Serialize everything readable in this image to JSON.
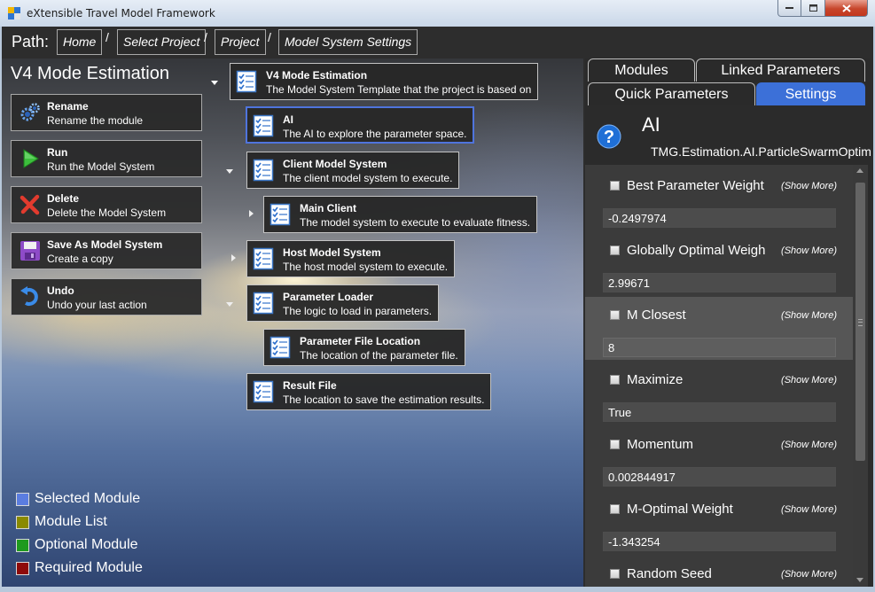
{
  "window": {
    "title": "eXtensible Travel Model Framework"
  },
  "path": {
    "label": "Path:",
    "separator": "/",
    "crumbs": [
      "Home",
      "Select Project",
      "Project",
      "Model System Settings"
    ]
  },
  "left": {
    "title": "V4 Mode Estimation",
    "actions": [
      {
        "icon": "gears-icon",
        "title": "Rename",
        "subtitle": "Rename the module"
      },
      {
        "icon": "play-icon",
        "title": "Run",
        "subtitle": "Run the Model System"
      },
      {
        "icon": "delete-x-icon",
        "title": "Delete",
        "subtitle": "Delete the Model System"
      },
      {
        "icon": "floppy-disk-icon",
        "title": "Save As Model System",
        "subtitle": "Create a copy"
      },
      {
        "icon": "undo-icon",
        "title": "Undo",
        "subtitle": "Undo your last action"
      }
    ],
    "tree": [
      {
        "title": "V4 Mode Estimation",
        "description": "The Model System Template that the project is based on",
        "selected": false
      },
      {
        "title": "AI",
        "description": "The AI to explore the parameter space.",
        "selected": true
      },
      {
        "title": "Client Model System",
        "description": "The client model system to execute.",
        "selected": false
      },
      {
        "title": "Main Client",
        "description": "The model system to execute to evaluate fitness.",
        "selected": false
      },
      {
        "title": "Host Model System",
        "description": "The host model system to execute.",
        "selected": false
      },
      {
        "title": "Parameter Loader",
        "description": "The logic to load in parameters.",
        "selected": false
      },
      {
        "title": "Parameter File Location",
        "description": "The location of the parameter file.",
        "selected": false
      },
      {
        "title": "Result File",
        "description": "The location to save the estimation results.",
        "selected": false
      }
    ],
    "legend": [
      {
        "label": "Selected Module",
        "color": "#5b7de0"
      },
      {
        "label": "Module List",
        "color": "#8a8a00"
      },
      {
        "label": "Optional Module",
        "color": "#1e9a1e"
      },
      {
        "label": "Required Module",
        "color": "#8e0a0a"
      }
    ]
  },
  "right": {
    "tabs": [
      {
        "label": "Modules",
        "active": false
      },
      {
        "label": "Linked Parameters",
        "active": false
      },
      {
        "label": "Quick Parameters",
        "active": false
      },
      {
        "label": "Settings",
        "active": true
      }
    ],
    "header": {
      "icon": "help-icon",
      "name": "AI",
      "type": "TMG.Estimation.AI.ParticleSwarmOptimi"
    },
    "show_more": "(Show More)",
    "parameters": [
      {
        "label": "Best Parameter Weight",
        "value": "-0.2497974",
        "checked": false,
        "highlighted": false
      },
      {
        "label": "Globally Optimal Weigh",
        "value": "2.99671",
        "checked": false,
        "highlighted": false
      },
      {
        "label": "M Closest",
        "value": "8",
        "checked": false,
        "highlighted": true
      },
      {
        "label": "Maximize",
        "value": "True",
        "checked": false,
        "highlighted": false
      },
      {
        "label": "Momentum",
        "value": "0.002844917",
        "checked": false,
        "highlighted": false
      },
      {
        "label": "M-Optimal Weight",
        "value": "-1.343254",
        "checked": false,
        "highlighted": false
      },
      {
        "label": "Random Seed",
        "value": "",
        "checked": false,
        "highlighted": false
      }
    ]
  }
}
